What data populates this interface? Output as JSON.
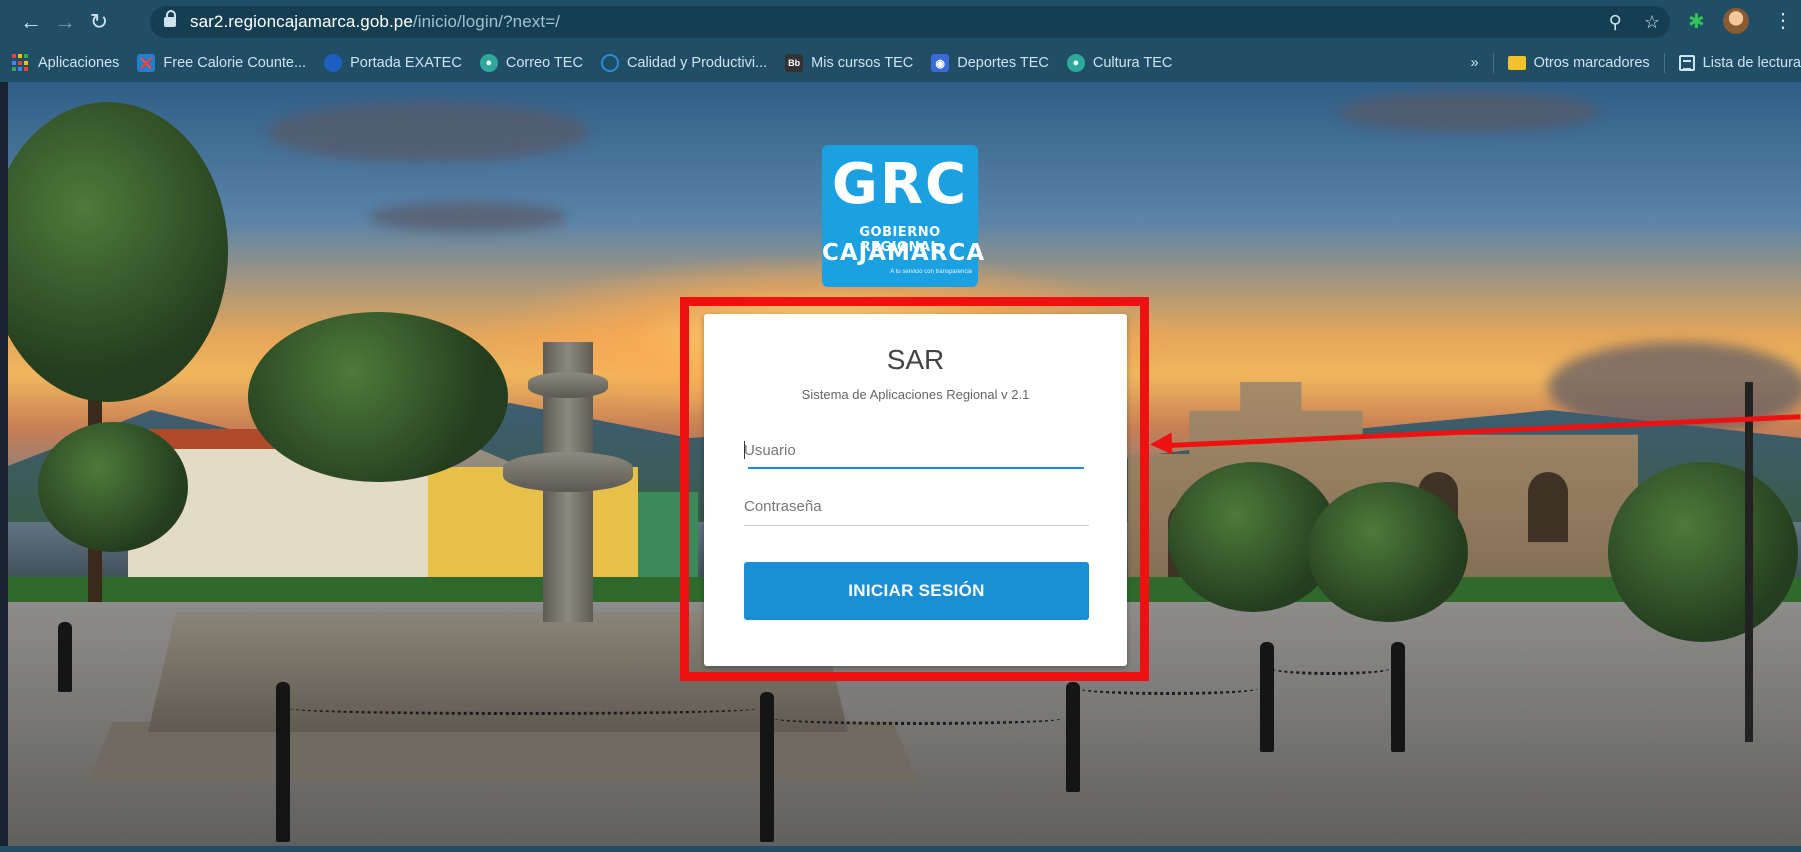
{
  "browser": {
    "url_domain": "sar2.regioncajamarca.gob.pe",
    "url_path": "/inicio/login/?next=/",
    "bookmarks": [
      {
        "label": "Aplicaciones",
        "icon": "apps-grid-icon"
      },
      {
        "label": "Free Calorie Counte...",
        "icon": "calorie-icon",
        "color": "#1f7fd1"
      },
      {
        "label": "Portada EXATEC",
        "icon": "exatec-icon",
        "color": "#1d5fbf"
      },
      {
        "label": "Correo TEC",
        "icon": "globe-icon",
        "color": "#2ea89a"
      },
      {
        "label": "Calidad y Productivi...",
        "icon": "circle-icon",
        "color": "#2e8ad8"
      },
      {
        "label": "Mis cursos TEC",
        "icon": "blackboard-icon",
        "color": "#333333"
      },
      {
        "label": "Deportes TEC",
        "icon": "deportes-icon",
        "color": "#3a6bd8"
      },
      {
        "label": "Cultura TEC",
        "icon": "globe-icon",
        "color": "#2ea89a"
      }
    ],
    "overflow_label": "»",
    "other_bookmarks": "Otros marcadores",
    "reading_list": "Lista de lectura"
  },
  "logo": {
    "acronym": "GRC",
    "line1": "GOBIERNO REGIONAL",
    "line2": "CAJAMARCA",
    "tagline": "A tu servicio con transparencia",
    "color": "#1ba1e2"
  },
  "login": {
    "title": "SAR",
    "subtitle": "Sistema de Aplicaciones Regional v 2.1",
    "username_placeholder": "Usuario",
    "password_placeholder": "Contraseña",
    "submit_label": "INICIAR SESIÓN",
    "accent_color": "#1b8fd6"
  },
  "annotation": {
    "highlight_color": "#ee1111"
  }
}
